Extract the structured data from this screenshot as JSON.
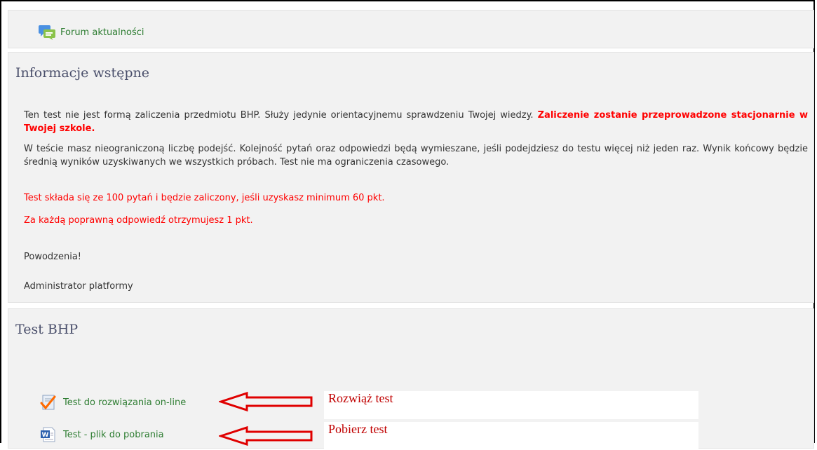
{
  "forum": {
    "link_label": "Forum aktualności"
  },
  "intro": {
    "title": "Informacje wstępne",
    "p1_text": "Ten test nie jest formą zaliczenia przedmiotu BHP. Służy jedynie orientacyjnemu sprawdzeniu Twojej wiedzy.",
    "p1_red": "Zaliczenie zostanie przeprowadzone stacjonarnie w Twojej szkole.",
    "p2_text": "W teście masz nieograniczoną liczbę podejść. Kolejność pytań oraz odpowiedzi będą wymieszane, jeśli podejdziesz do testu więcej niż jeden raz. Wynik końcowy będzie średnią wyników uzyskiwanych we wszystkich próbach. Test nie ma ograniczenia czasowego.",
    "p3_red": "Test składa się ze 100 pytań i będzie zaliczony, jeśli uzyskasz minimum 60 pkt.",
    "p4_red": "Za każdą poprawną odpowiedź otrzymujesz 1 pkt.",
    "greeting": "Powodzenia!",
    "signature": "Administrator platformy"
  },
  "test_section": {
    "title": "Test BHP",
    "online_label": "Test do rozwiązania on-line",
    "download_label": "Test - plik do pobrania",
    "note_online": "Rozwiąż test",
    "note_download": "Pobierz test"
  },
  "colors": {
    "accent_green": "#2e7d32",
    "warning_red": "#ff0000",
    "arrow_red": "#e00000"
  },
  "icons": {
    "forum": "forum-icon",
    "quiz": "quiz-checkmark-icon",
    "word": "word-document-icon"
  }
}
